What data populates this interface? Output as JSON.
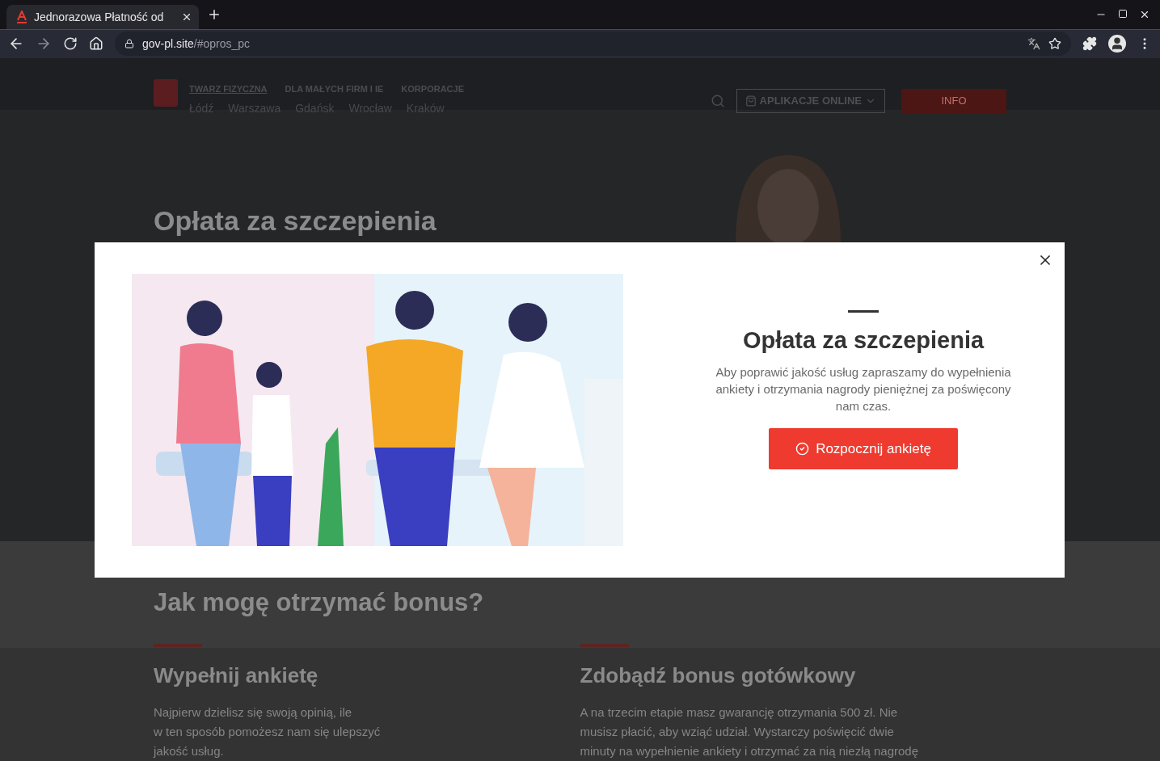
{
  "browser": {
    "tab": {
      "title": "Jednorazowa Płatność od",
      "selected": true
    },
    "url": {
      "host": "gov-pl.site",
      "path": "/#opros_pc"
    }
  },
  "site": {
    "nav": [
      {
        "label": "TWARZ FIZYCZNA",
        "selected": true
      },
      {
        "label": "DLA MAŁYCH FIRM I IE",
        "selected": false
      },
      {
        "label": "KORPORACJE",
        "selected": false
      }
    ],
    "cities": [
      "Łódź",
      "Warszawa",
      "Gdańsk",
      "Wrocław",
      "Kraków"
    ],
    "apps_button": "APLIKACJE ONLINE",
    "info_button": "INFO",
    "hero_title": "Opłata za szczepienia",
    "section_title": "Jak mogę otrzymać bonus?",
    "cards": [
      {
        "title": "Wypełnij ankietę",
        "lines": [
          "Najpierw dzielisz się swoją opinią, ile",
          "w ten sposób pomożesz nam się ulepszyć",
          "jakość usług."
        ]
      },
      {
        "title": "Zdobądź bonus gotówkowy",
        "lines": [
          "A na trzecim etapie masz gwarancję otrzymania 500 zł. Nie",
          "musisz płacić, aby wziąć udział. Wystarczy poświęcić dwie",
          "minuty na wypełnienie ankiety i otrzymać za nią niezłą nagrodę"
        ]
      }
    ]
  },
  "modal": {
    "title": "Opłata za szczepienia",
    "text": "Aby poprawić jakość usług zapraszamy do wypełnienia ankiety i otrzymania nagrody pieniężnej za poświęcony nam czas.",
    "button": "Rozpocznij ankietę"
  }
}
